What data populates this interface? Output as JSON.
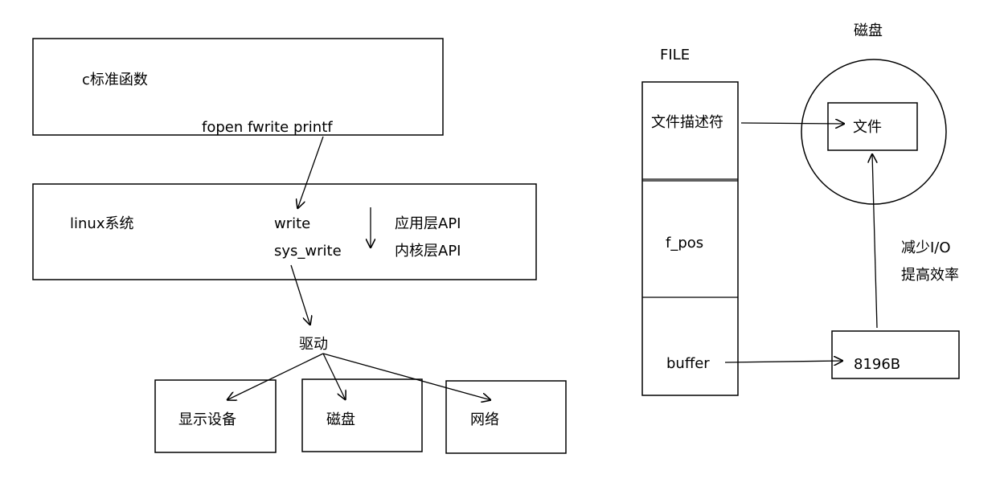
{
  "left": {
    "c_lib_box": {
      "title": "c标准函数",
      "functions": "fopen  fwrite printf"
    },
    "linux_box": {
      "title": "linux系统",
      "write": "write",
      "sys_write": "sys_write",
      "app_api": "应用层API",
      "kernel_api": "内核层API"
    },
    "driver": "驱动",
    "devices": [
      "显示设备",
      "磁盘",
      "网络"
    ]
  },
  "right": {
    "file_struct": {
      "title": "FILE",
      "fields": [
        "文件描述符",
        "f_pos",
        "buffer"
      ]
    },
    "disk": {
      "title": "磁盘",
      "file": "文件"
    },
    "buffer_box": "8196B",
    "note": [
      "减少I/O",
      "提高效率"
    ]
  }
}
